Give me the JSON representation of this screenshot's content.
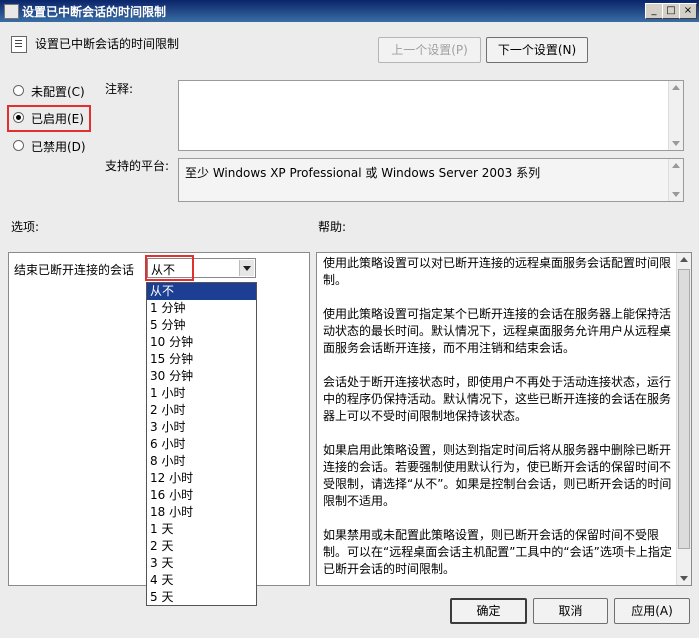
{
  "window": {
    "title": "设置已中断会话的时间限制",
    "controls": {
      "minimize": "_",
      "maximize": "□",
      "close": "×"
    }
  },
  "header": {
    "policy_title": "设置已中断会话的时间限制",
    "prev_button": "上一个设置(P)",
    "next_button": "下一个设置(N)"
  },
  "state": {
    "options": [
      {
        "label": "未配置(C)",
        "selected": false
      },
      {
        "label": "已启用(E)",
        "selected": true
      },
      {
        "label": "已禁用(D)",
        "selected": false
      }
    ]
  },
  "comment": {
    "label": "注释:",
    "value": ""
  },
  "platform": {
    "label": "支持的平台:",
    "value": "至少 Windows XP Professional 或 Windows Server 2003 系列"
  },
  "options_section": {
    "label": "选项:",
    "setting_label": "结束已断开连接的会话",
    "selected_value": "从不",
    "dropdown_items": [
      "从不",
      "1 分钟",
      "5 分钟",
      "10 分钟",
      "15 分钟",
      "30 分钟",
      "1 小时",
      "2 小时",
      "3 小时",
      "6 小时",
      "8 小时",
      "12 小时",
      "16 小时",
      "18 小时",
      "1 天",
      "2 天",
      "3 天",
      "4 天",
      "5 天"
    ],
    "dropdown_selected_index": 0
  },
  "help_section": {
    "label": "帮助:",
    "paragraphs": [
      "使用此策略设置可以对已断开连接的远程桌面服务会话配置时间限制。",
      "使用此策略设置可指定某个已断开连接的会话在服务器上能保持活动状态的最长时间。默认情况下，远程桌面服务允许用户从远程桌面服务会话断开连接，而不用注销和结束会话。",
      "会话处于断开连接状态时，即使用户不再处于活动连接状态，运行中的程序仍保持活动。默认情况下，这些已断开连接的会话在服务器上可以不受时间限制地保持该状态。",
      "如果启用此策略设置，则达到指定时间后将从服务器中删除已断开连接的会话。若要强制使用默认行为，使已断开会话的保留时间不受限制，请选择“从不”。如果是控制台会话，则已断开会话的时间限制不适用。",
      "如果禁用或未配置此策略设置，则已断开会话的保留时间不受限制。可以在“远程桌面会话主机配置”工具中的“会话”选项卡上指定已断开会话的时间限制。"
    ]
  },
  "footer": {
    "ok_button": "确定",
    "cancel_button": "取消",
    "apply_button": "应用(A)"
  }
}
